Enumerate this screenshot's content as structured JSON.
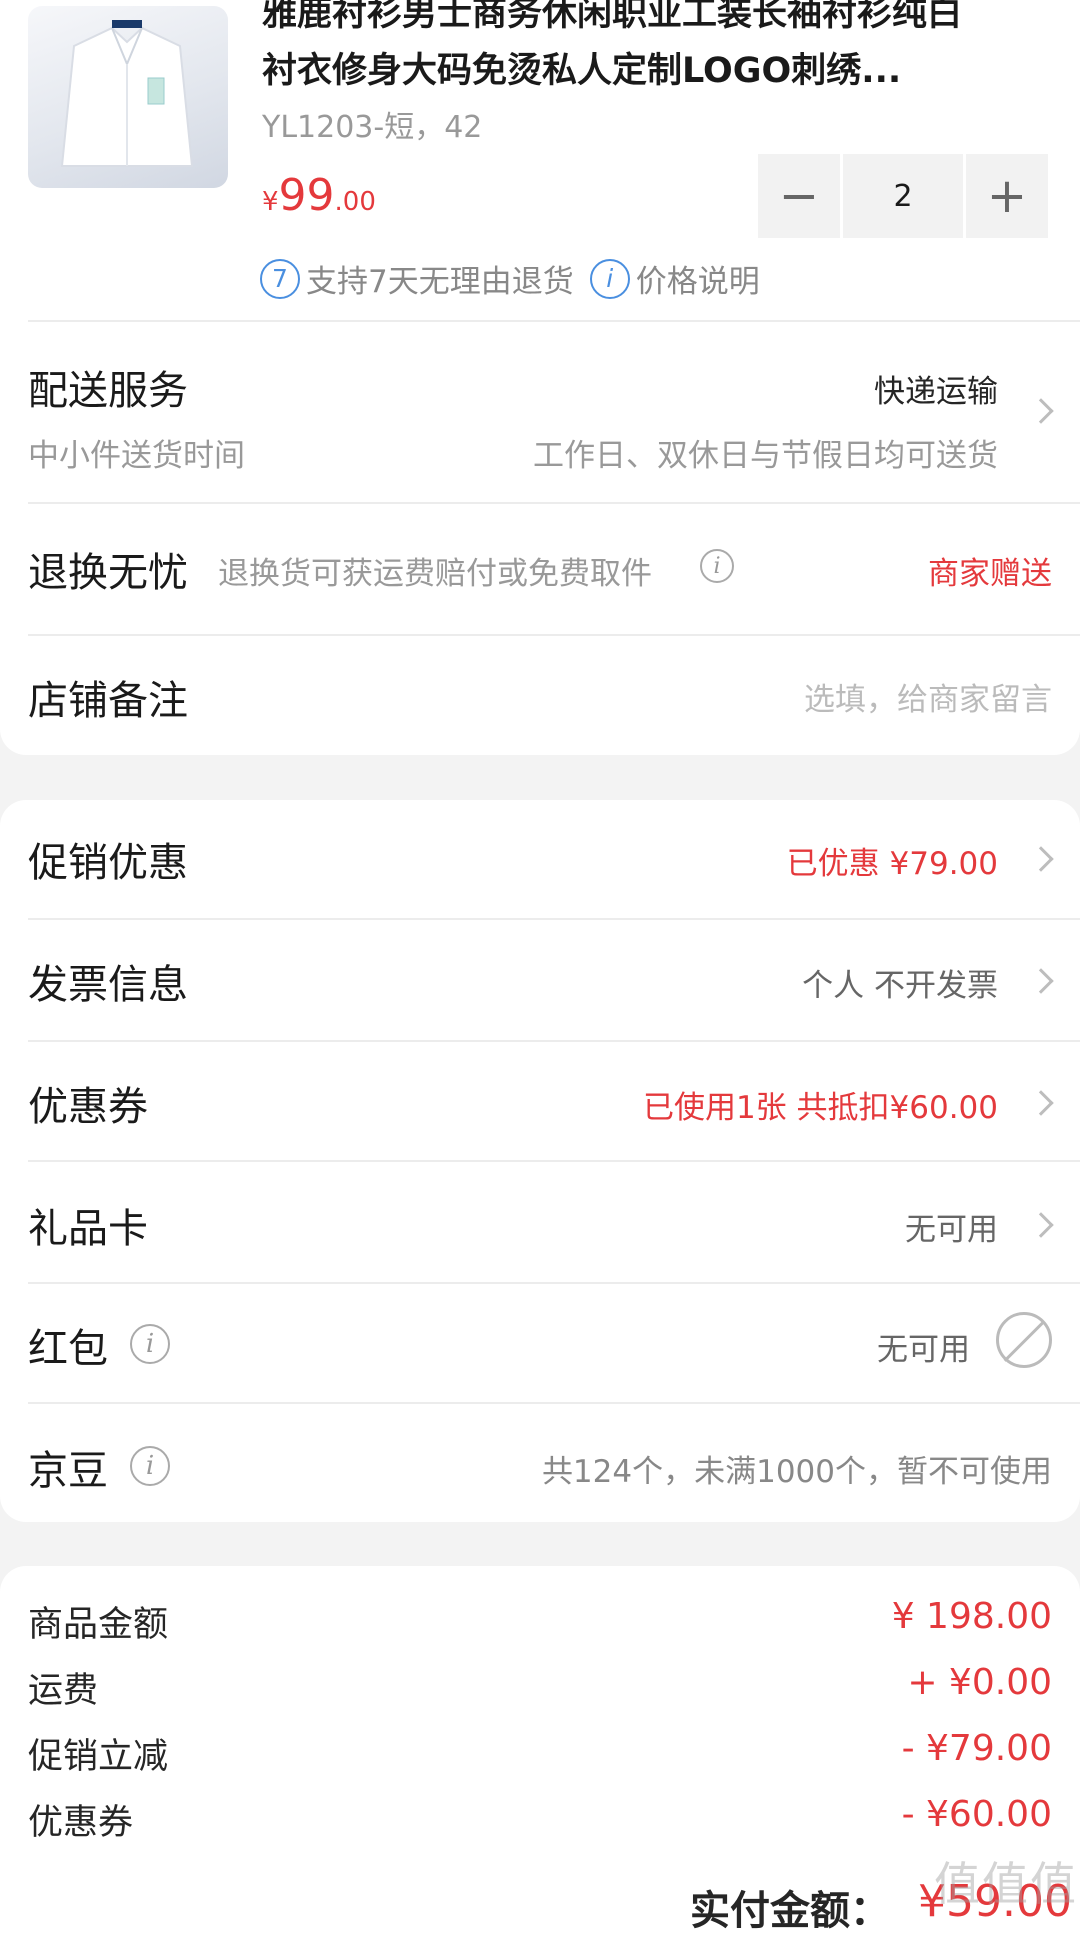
{
  "product": {
    "title_line1": "雅鹿衬衫男士商务休闲职业工装长袖衬衫纯白",
    "title_line2": "衬衣修身大码免烫私人定制LOGO刺绣...",
    "spec": "YL1203-短，42",
    "price_currency": "¥",
    "price_int": "99",
    "price_dec": ".00",
    "qty_minus": "−",
    "qty": "2",
    "qty_plus": "+",
    "return_badge": "7",
    "return_text": "支持7天无理由退货",
    "price_note_badge": "i",
    "price_note": "价格说明"
  },
  "delivery": {
    "label": "配送服务",
    "method": "快递运输",
    "sub_label": "中小件送货时间",
    "sub_value": "工作日、双休日与节假日均可送货"
  },
  "return_service": {
    "label": "退换无忧",
    "desc": "退换货可获运费赔付或免费取件",
    "value": "商家赠送"
  },
  "remark": {
    "label": "店铺备注",
    "placeholder": "选填，给商家留言"
  },
  "rows": [
    {
      "label": "促销优惠",
      "value": "已优惠 ¥79.00"
    },
    {
      "label": "发票信息",
      "value": "个人 不开发票"
    },
    {
      "label": "优惠券",
      "value": "已使用1张 共抵扣¥60.00"
    },
    {
      "label": "礼品卡",
      "value": "无可用"
    },
    {
      "label": "红包",
      "value": "无可用"
    },
    {
      "label": "京豆",
      "value": "共124个，未满1000个，暂不可使用"
    }
  ],
  "summary": [
    {
      "label": "商品金额",
      "value": "¥ 198.00"
    },
    {
      "label": "运费",
      "value": "+ ¥0.00"
    },
    {
      "label": "促销立减",
      "value": "- ¥79.00"
    },
    {
      "label": "优惠券",
      "value": "- ¥60.00"
    }
  ],
  "pay": {
    "label": "实付金额：",
    "value": "¥59.00"
  },
  "watermark": "值值值",
  "colors": {
    "accent_red": "#e4393c",
    "info_blue": "#4a8fe0",
    "background": "#f3f3f3"
  }
}
